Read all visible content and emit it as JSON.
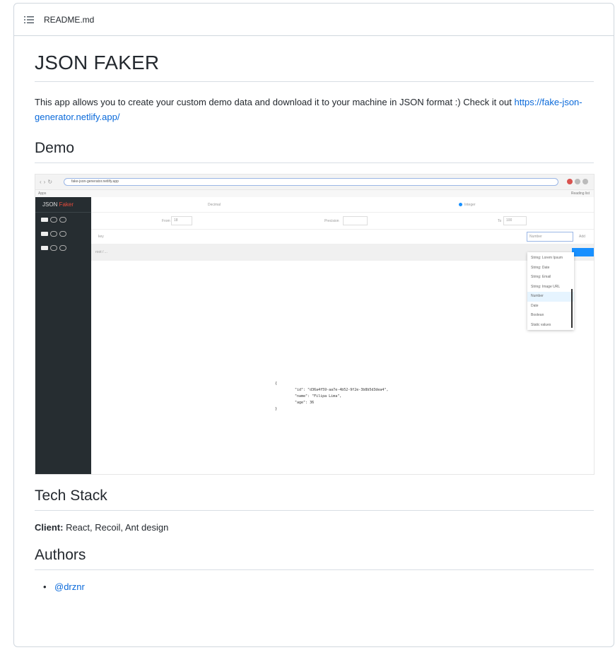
{
  "header": {
    "filename": "README.md",
    "icon": "list-icon"
  },
  "title": "JSON FAKER",
  "intro": {
    "text": "This app allows you to create your custom demo data and download it to your machine in JSON format :) Check it out",
    "link": "https://fake-json-generator.netlify.app/"
  },
  "demo": {
    "heading": "Demo",
    "screenshot": {
      "url": "fake-json-generator.netlify.app",
      "bookmarks_left": "Apps",
      "bookmarks_right": "Reading list",
      "logo_a": "JSON ",
      "logo_b": "Faker",
      "decimal": "Decimal",
      "integer": "Integer",
      "from": "From",
      "from_value": "18",
      "precision": "Precision",
      "to": "To",
      "to_value": "100",
      "key": "key",
      "type_value": "Number",
      "add": "Add",
      "path": "root / ...",
      "dropdown": [
        "String: Lorem Ipsum",
        "String: Date",
        "String: Email",
        "String: Image URL",
        "Number",
        "Date",
        "Boolean",
        "Static values"
      ],
      "json_lines": [
        "{",
        "\"id\": \"d36a4f59-aa7e-4b52-9f2e-3b8b5d3dea4\",",
        "\"name\": \"Filipa Lima\",",
        "\"age\": 36",
        "}"
      ]
    }
  },
  "tech": {
    "heading": "Tech Stack",
    "label": "Client:",
    "value": " React, Recoil, Ant design"
  },
  "authors": {
    "heading": "Authors",
    "items": [
      "@drznr"
    ]
  }
}
